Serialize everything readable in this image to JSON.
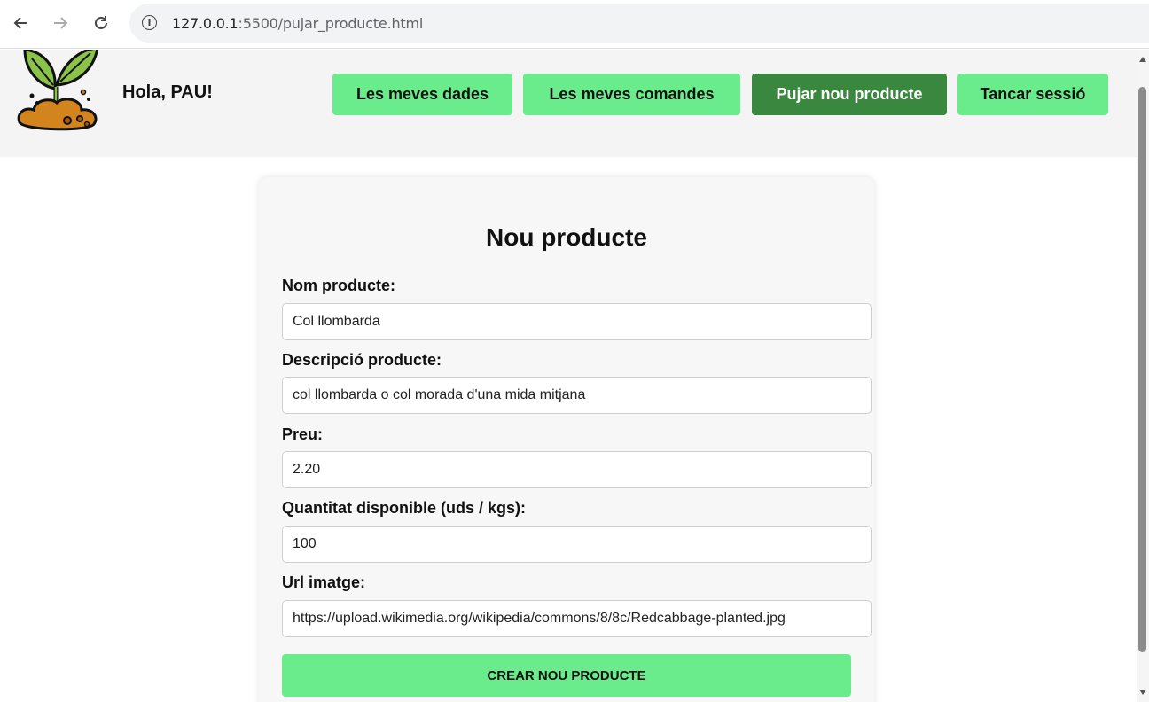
{
  "browser": {
    "url_host": "127.0.0.1",
    "url_rest": ":5500/pujar_producte.html"
  },
  "header": {
    "greeting": "Hola, PAU!",
    "nav": [
      {
        "label": "Les meves dades"
      },
      {
        "label": "Les meves comandes"
      },
      {
        "label": "Pujar nou producte"
      },
      {
        "label": "Tancar sessió"
      }
    ]
  },
  "form": {
    "title": "Nou producte",
    "fields": [
      {
        "label": "Nom producte:",
        "value": "Col llombarda"
      },
      {
        "label": "Descripció producte:",
        "value": "col llombarda o col morada d'una mida mitjana"
      },
      {
        "label": "Preu:",
        "value": "2.20"
      },
      {
        "label": "Quantitat disponible (uds / kgs):",
        "value": "100"
      },
      {
        "label": "Url imatge:",
        "value": "https://upload.wikimedia.org/wikipedia/commons/8/8c/Redcabbage-planted.jpg"
      }
    ],
    "submit_label": "CREAR NOU PRODUCTE"
  },
  "colors": {
    "button_green": "#6aec8c",
    "active_green": "#3a873f"
  },
  "icons": [
    "back-arrow-icon",
    "forward-arrow-icon",
    "reload-icon",
    "info-icon",
    "sprout-logo"
  ]
}
